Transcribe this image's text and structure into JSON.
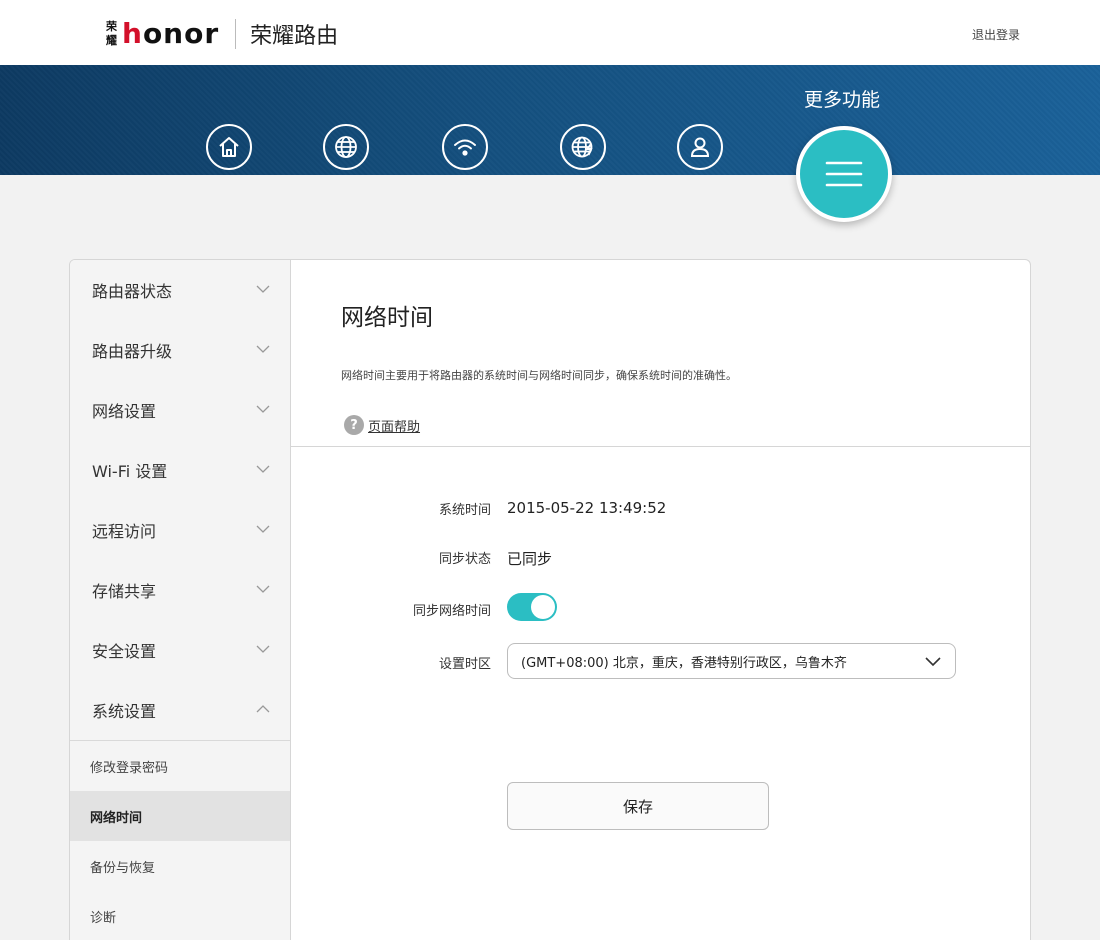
{
  "header": {
    "logo_seal_chars": [
      "荣",
      "耀"
    ],
    "logo_text_prefix": "h",
    "logo_text_rest": "onor",
    "app_title": "荣耀路由",
    "logout": "退出登录"
  },
  "banner": {
    "icons": [
      "home-icon",
      "globe-icon",
      "wifi-icon",
      "globe-lightning-icon",
      "user-icon"
    ],
    "more_label": "更多功能",
    "more_icon": "menu-icon",
    "accent_color": "#2bbec3"
  },
  "sidebar": {
    "items": [
      {
        "label": "路由器状态",
        "expanded": false
      },
      {
        "label": "路由器升级",
        "expanded": false
      },
      {
        "label": "网络设置",
        "expanded": false
      },
      {
        "label": "Wi-Fi 设置",
        "expanded": false
      },
      {
        "label": "远程访问",
        "expanded": false
      },
      {
        "label": "存储共享",
        "expanded": false
      },
      {
        "label": "安全设置",
        "expanded": false
      },
      {
        "label": "系统设置",
        "expanded": true
      }
    ],
    "sub_items": [
      {
        "label": "修改登录密码",
        "active": false
      },
      {
        "label": "网络时间",
        "active": true
      },
      {
        "label": "备份与恢复",
        "active": false
      },
      {
        "label": "诊断",
        "active": false
      }
    ]
  },
  "main": {
    "title": "网络时间",
    "description": "网络时间主要用于将路由器的系统时间与网络时间同步，确保系统时间的准确性。",
    "help_label": "页面帮助",
    "help_icon_glyph": "?",
    "fields": {
      "system_time_label": "系统时间",
      "system_time_value": "2015-05-22 13:49:52",
      "sync_status_label": "同步状态",
      "sync_status_value": "已同步",
      "sync_toggle_label": "同步网络时间",
      "sync_toggle_on": true,
      "timezone_label": "设置时区",
      "timezone_value": "(GMT+08:00) 北京，重庆，香港特别行政区，乌鲁木齐"
    },
    "save_label": "保存"
  }
}
